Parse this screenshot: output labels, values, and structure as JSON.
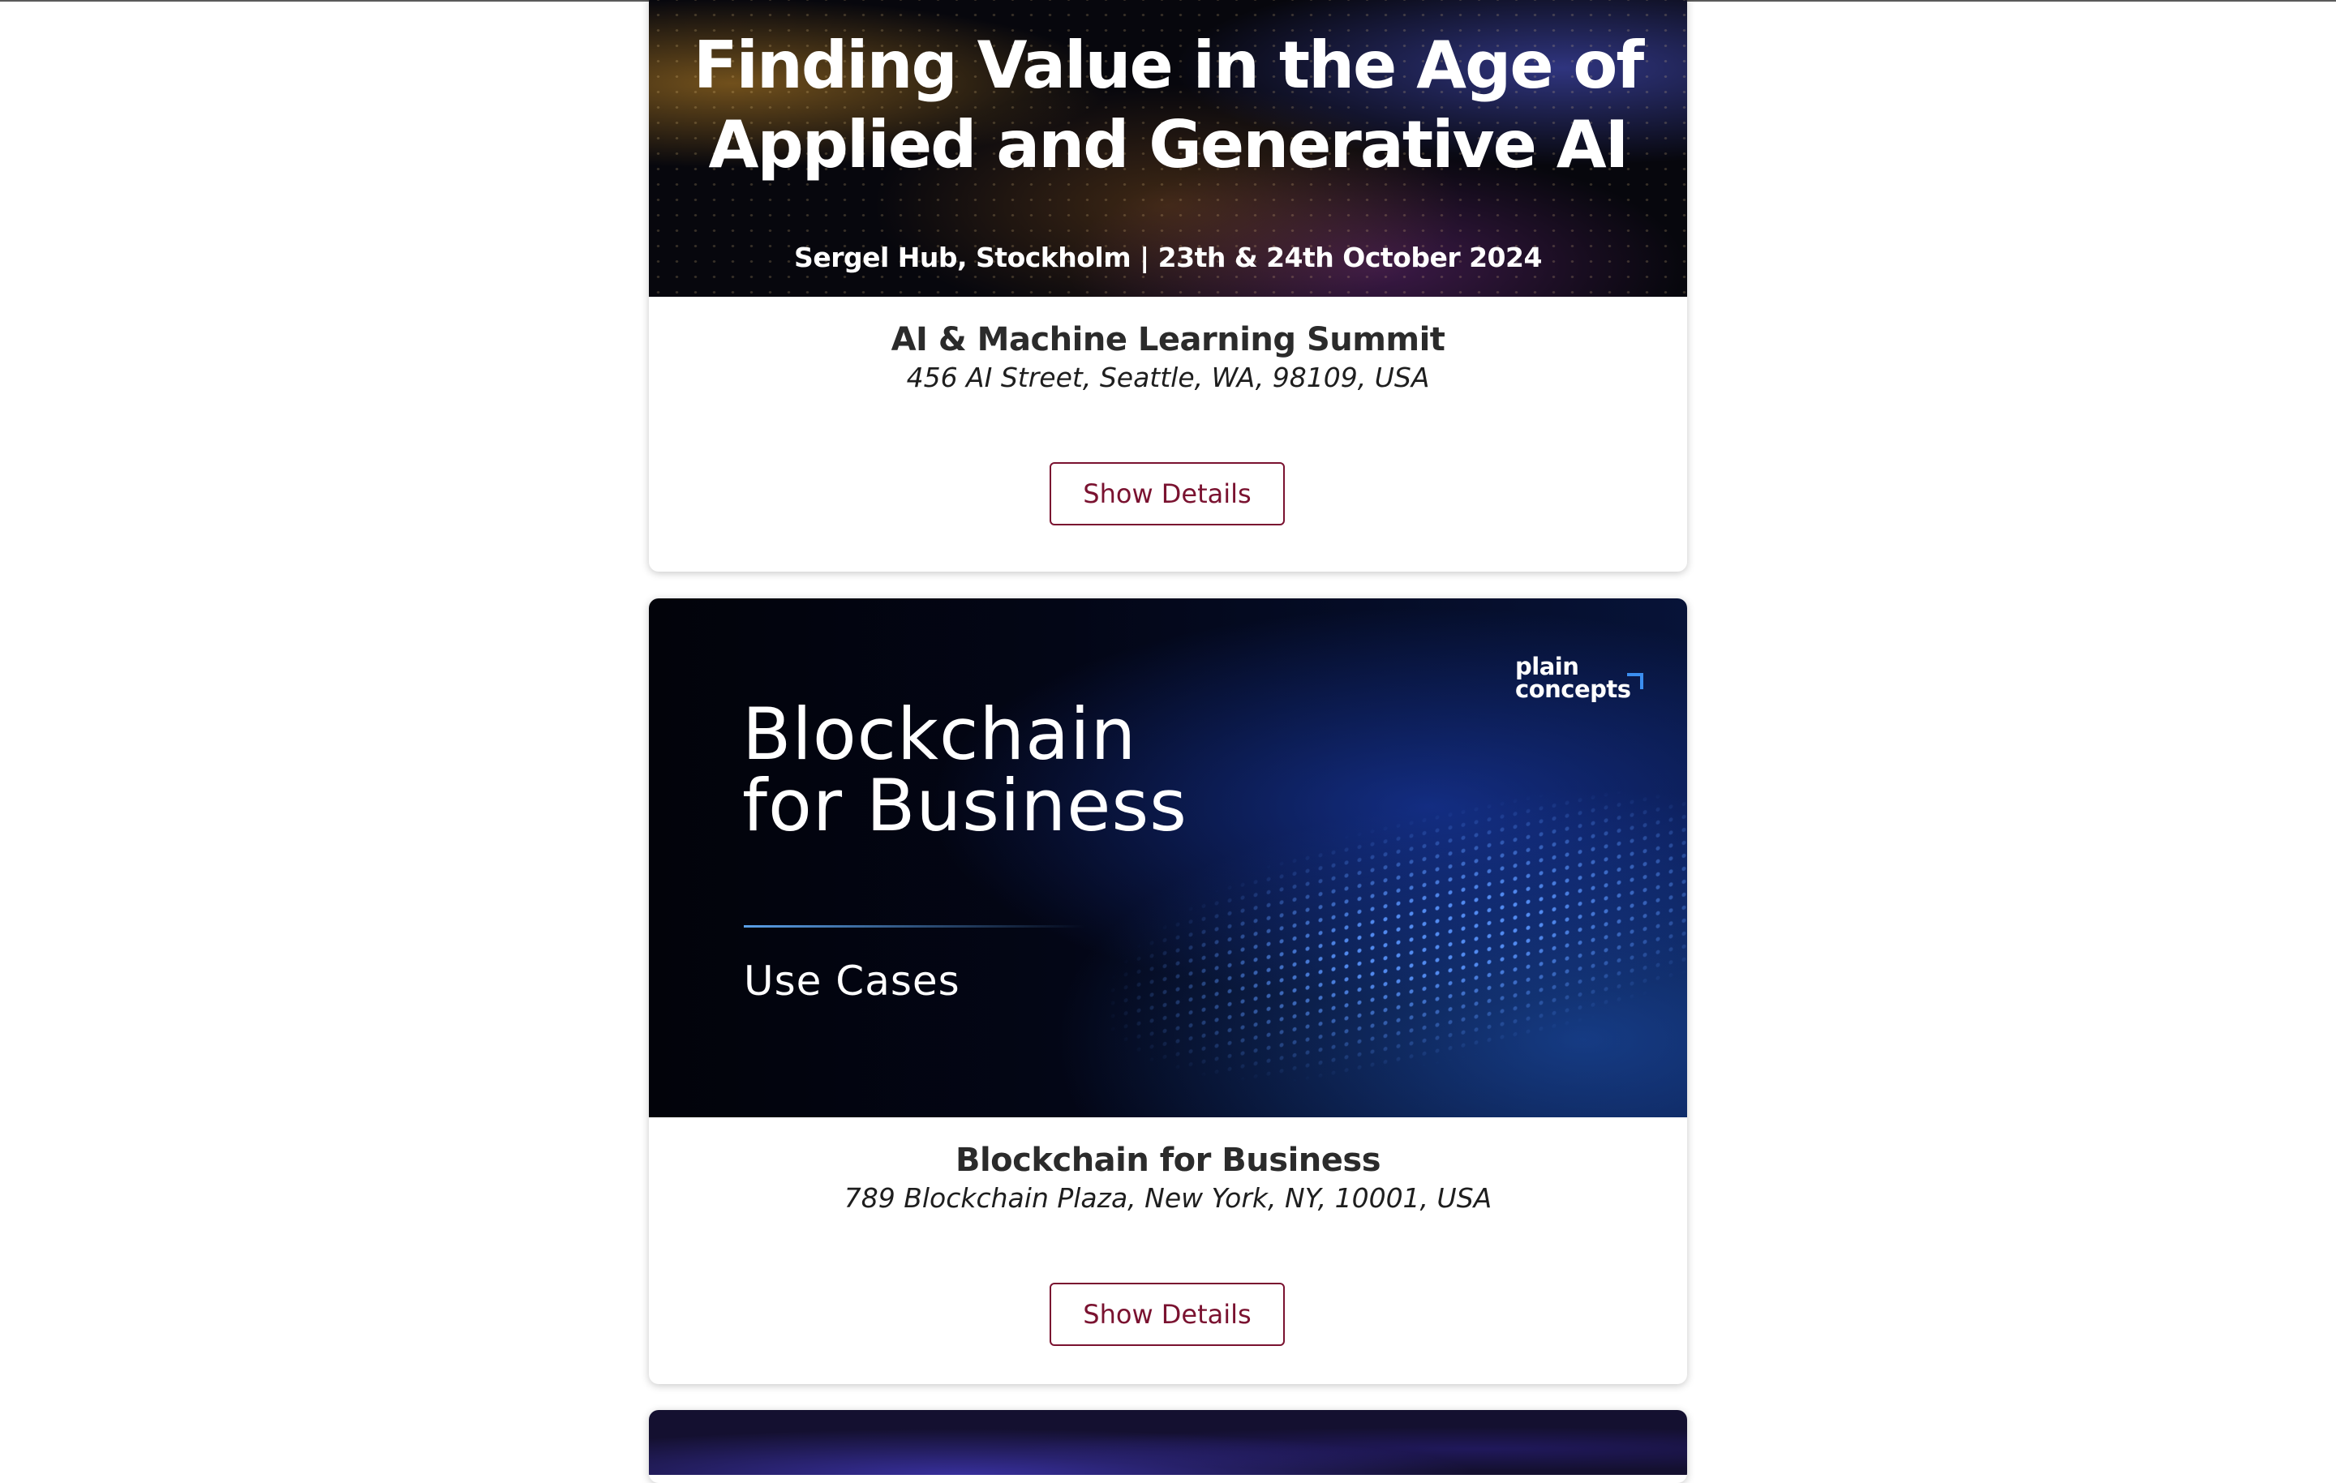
{
  "events": [
    {
      "banner": {
        "headline_line1": "Finding Value in the Age of",
        "headline_line2": "Applied and Generative AI",
        "subline": "Sergel Hub, Stockholm | 23th & 24th October 2024"
      },
      "title": "AI & Machine Learning Summit",
      "address": "456 AI Street, Seattle, WA, 98109, USA",
      "button_label": "Show Details"
    },
    {
      "banner": {
        "logo_line1": "plain",
        "logo_line2": "concepts",
        "headline_line1": "Blockchain",
        "headline_line2": "for Business",
        "subline": "Use Cases"
      },
      "title": "Blockchain for Business",
      "address": "789 Blockchain Plaza, New York, NY, 10001, USA",
      "button_label": "Show Details"
    }
  ],
  "colors": {
    "button_accent": "#7a1230",
    "title_text": "#2b2b2b",
    "page_background": "#ffffff"
  }
}
